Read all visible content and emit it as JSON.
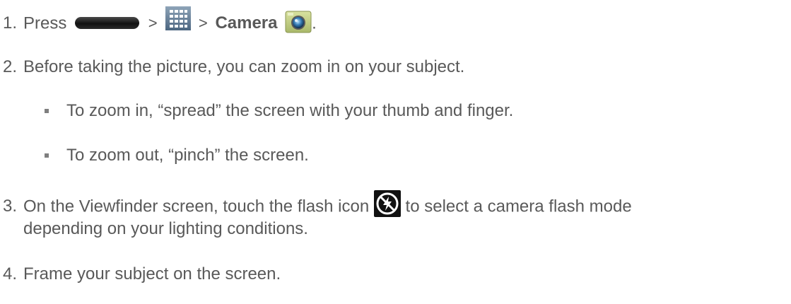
{
  "steps": [
    {
      "number": "1.",
      "press": "Press",
      "sep1": ">",
      "sep2": ">",
      "camera_label": "Camera",
      "end": "."
    },
    {
      "number": "2.",
      "text": "Before taking the picture, you can zoom in on your subject.",
      "bullets": [
        "To zoom in, “spread” the screen with your thumb and finger.",
        "To zoom out, “pinch” the screen."
      ]
    },
    {
      "number": "3.",
      "text_before": "On the Viewfinder screen, touch the flash icon",
      "text_after": "to select a camera flash mode",
      "continuation": "depending on your lighting conditions."
    },
    {
      "number": "4.",
      "text": "Frame your subject on the screen."
    }
  ],
  "icons": {
    "home_key": "home-key-icon",
    "apps": "apps-grid-icon",
    "camera": "camera-app-icon",
    "flash": "flash-off-icon"
  },
  "colors": {
    "text": "#595959",
    "bullet": "#7f7f7f"
  }
}
